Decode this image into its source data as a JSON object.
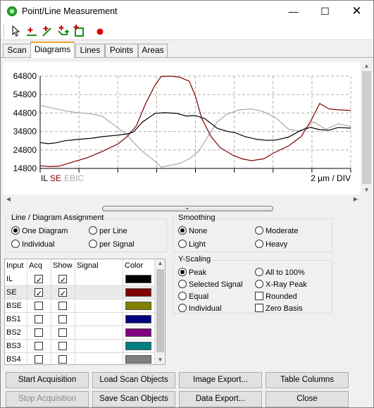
{
  "window": {
    "title": "Point/Line Measurement",
    "minimize_glyph": "—",
    "maximize_glyph": "☐",
    "close_glyph": "✕"
  },
  "toolbar": {
    "items": [
      {
        "name": "select-pointer-icon"
      },
      {
        "name": "add-point-icon"
      },
      {
        "name": "add-line-icon"
      },
      {
        "name": "add-polyline-icon"
      },
      {
        "name": "add-area-icon"
      },
      {
        "name": "record-icon"
      }
    ]
  },
  "tabs": [
    "Scan",
    "Diagrams",
    "Lines",
    "Points",
    "Areas"
  ],
  "active_tab": "Diagrams",
  "chart_data": {
    "type": "line",
    "y_tick_labels": [
      "64800",
      "54800",
      "44800",
      "34800",
      "24800",
      "14800"
    ],
    "ylim": [
      14800,
      64800
    ],
    "x_scale_label": "2 µm / DIV",
    "grid": "dashed",
    "series": [
      {
        "name": "IL",
        "color": "#000000",
        "x": [
          0,
          0.025,
          0.05,
          0.08,
          0.12,
          0.17,
          0.2,
          0.25,
          0.28,
          0.3,
          0.33,
          0.37,
          0.4,
          0.44,
          0.47,
          0.5,
          0.53,
          0.57,
          0.6,
          0.63,
          0.66,
          0.7,
          0.73,
          0.76,
          0.8,
          0.84,
          0.87,
          0.9,
          0.93,
          0.96,
          1.0
        ],
        "y": [
          28800,
          28200,
          28600,
          29800,
          30500,
          31200,
          32000,
          32800,
          33500,
          34500,
          40000,
          44600,
          45000,
          44600,
          43200,
          43400,
          41800,
          36500,
          35000,
          34000,
          32000,
          30500,
          30000,
          30200,
          31800,
          35500,
          37000,
          35800,
          35500,
          37000,
          36600
        ]
      },
      {
        "name": "SE",
        "color": "#800000",
        "x": [
          0,
          0.03,
          0.06,
          0.1,
          0.15,
          0.2,
          0.25,
          0.28,
          0.31,
          0.34,
          0.37,
          0.39,
          0.42,
          0.45,
          0.48,
          0.5,
          0.52,
          0.55,
          0.58,
          0.62,
          0.65,
          0.68,
          0.72,
          0.75,
          0.8,
          0.84,
          0.87,
          0.9,
          0.93,
          0.96,
          1.0
        ],
        "y": [
          16200,
          15800,
          16000,
          18000,
          20500,
          24000,
          28000,
          32000,
          38000,
          50000,
          60000,
          64600,
          64800,
          64200,
          62000,
          54000,
          42000,
          32000,
          26000,
          22000,
          20000,
          19000,
          20000,
          23000,
          27000,
          32000,
          40000,
          50000,
          47000,
          46500,
          46200
        ]
      },
      {
        "name": "EBIC",
        "color": "#a8a8a8",
        "x": [
          0,
          0.04,
          0.08,
          0.12,
          0.16,
          0.2,
          0.24,
          0.28,
          0.3,
          0.33,
          0.36,
          0.39,
          0.42,
          0.45,
          0.48,
          0.51,
          0.54,
          0.57,
          0.6,
          0.64,
          0.68,
          0.72,
          0.76,
          0.8,
          0.84,
          0.88,
          0.92,
          0.96,
          1.0
        ],
        "y": [
          49000,
          47500,
          46000,
          45000,
          44500,
          43000,
          38000,
          33000,
          29000,
          24000,
          20000,
          15500,
          16500,
          17500,
          20000,
          24000,
          32000,
          40000,
          44000,
          46500,
          47000,
          45500,
          42000,
          36000,
          35000,
          40000,
          36000,
          39000,
          37500
        ]
      }
    ]
  },
  "line_assignment": {
    "title": "Line / Diagram Assignment",
    "options": [
      {
        "label": "One Diagram",
        "selected": true
      },
      {
        "label": "per Line",
        "selected": false
      },
      {
        "label": "Individual",
        "selected": false
      },
      {
        "label": "per Signal",
        "selected": false
      }
    ]
  },
  "smoothing": {
    "title": "Smoothing",
    "options": [
      {
        "label": "None",
        "selected": true
      },
      {
        "label": "Moderate",
        "selected": false
      },
      {
        "label": "Light",
        "selected": false
      },
      {
        "label": "Heavy",
        "selected": false
      }
    ]
  },
  "y_scaling": {
    "title": "Y-Scaling",
    "radios": [
      {
        "label": "Peak",
        "selected": true
      },
      {
        "label": "All to 100%",
        "selected": false
      },
      {
        "label": "Selected Signal",
        "selected": false
      },
      {
        "label": "X-Ray Peak",
        "selected": false
      },
      {
        "label": "Equal",
        "selected": false
      },
      {
        "label": "Individual",
        "selected": false
      }
    ],
    "checks": [
      {
        "label": "Rounded",
        "checked": false
      },
      {
        "label": "Zero Basis",
        "checked": false
      }
    ]
  },
  "signal_table": {
    "headers": [
      "Input",
      "Acq",
      "Show",
      "Signal",
      "Color"
    ],
    "rows": [
      {
        "input": "IL",
        "acq": true,
        "show": true,
        "signal": "",
        "color": "#000000"
      },
      {
        "input": "SE",
        "acq": true,
        "show": true,
        "signal": "",
        "color": "#800000",
        "selected": true
      },
      {
        "input": "BSE",
        "acq": false,
        "show": false,
        "signal": "",
        "color": "#808000"
      },
      {
        "input": "BS1",
        "acq": false,
        "show": false,
        "signal": "",
        "color": "#000080"
      },
      {
        "input": "BS2",
        "acq": false,
        "show": false,
        "signal": "",
        "color": "#800080"
      },
      {
        "input": "BS3",
        "acq": false,
        "show": false,
        "signal": "",
        "color": "#008080"
      },
      {
        "input": "BS4",
        "acq": false,
        "show": false,
        "signal": "",
        "color": "#808080"
      }
    ]
  },
  "buttons": {
    "start_acquisition": "Start Acquisition",
    "stop_acquisition": "Stop Acquisition",
    "load_scan_objects": "Load Scan Objects",
    "save_scan_objects": "Save Scan Objects",
    "image_export": "Image Export...",
    "data_export": "Data Export...",
    "table_columns": "Table Columns",
    "close": "Close"
  }
}
